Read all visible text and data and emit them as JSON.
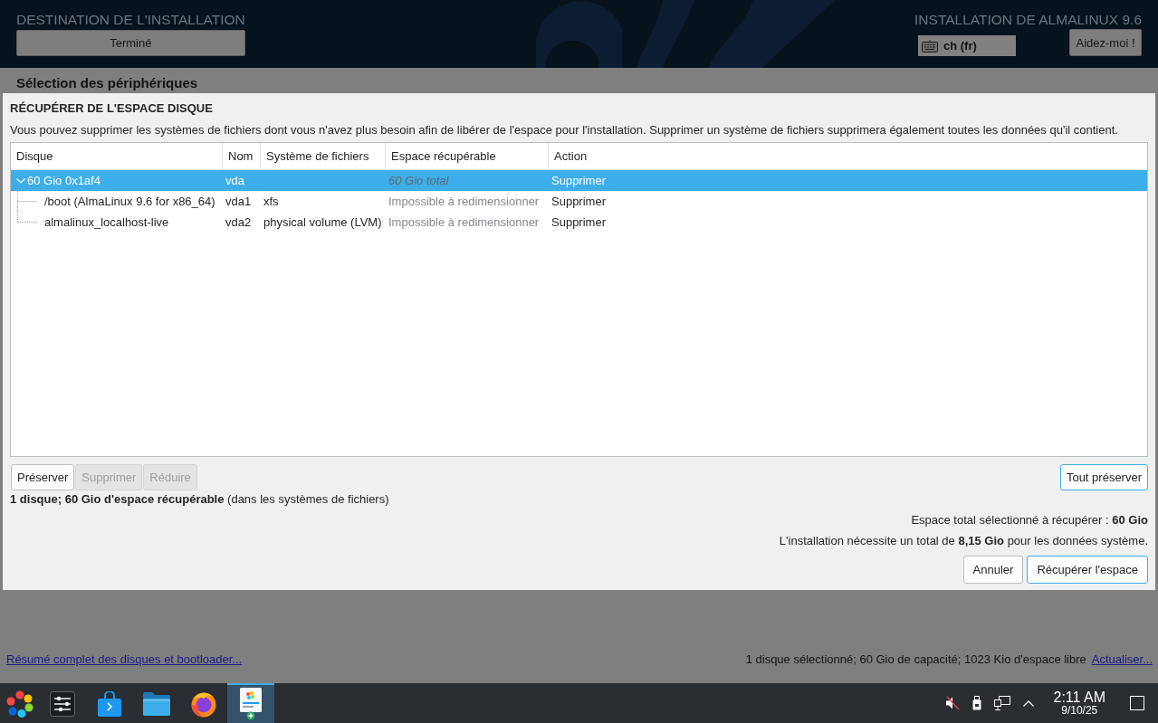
{
  "header": {
    "title": "DESTINATION DE L'INSTALLATION",
    "done_button": "Terminé",
    "product": "INSTALLATION DE ALMALINUX 9.6",
    "keyboard_layout": "ch (fr)",
    "help_button": "Aidez-moi !"
  },
  "section_title": "Sélection des périphériques",
  "dialog": {
    "title": "RÉCUPÉRER DE L'ESPACE DISQUE",
    "description": "Vous pouvez supprimer les systèmes de fichiers dont vous n'avez plus besoin afin de libérer de l'espace pour l'installation. Supprimer un système de fichiers supprimera également toutes les données qu'il contient.",
    "table": {
      "columns": [
        "Disque",
        "Nom",
        "Système de fichiers",
        "Espace récupérable",
        "Action"
      ],
      "rows": [
        {
          "disk": "60 Gio 0x1af4",
          "name": "vda",
          "reclaimable": "60 Gio total",
          "action": "Supprimer",
          "selected": true,
          "expanded": true,
          "children": [
            {
              "disk": "/boot (AlmaLinux 9.6 for x86_64)",
              "name": "vda1",
              "filesystem": "xfs",
              "reclaimable": "Impossible à redimensionner",
              "action": "Supprimer",
              "selected": false
            },
            {
              "disk": "almalinux_localhost-live",
              "name": "vda2",
              "filesystem": "physical volume (LVM)",
              "reclaimable": "Impossible à redimensionner",
              "action": "Supprimer",
              "selected": false
            }
          ]
        }
      ]
    },
    "tree_buttons": [
      {
        "label": "Préserver",
        "disabled": false
      },
      {
        "label": "Supprimer",
        "disabled": true
      },
      {
        "label": "Réduire",
        "disabled": true
      }
    ],
    "preserve_all_button": {
      "label": "Tout préserver",
      "highlighted": true
    },
    "summary": "**1 disque; 60 Gio d'espace récupérable** (dans les systèmes de fichiers)",
    "selected_total": "Espace total sélectionné à récupérer : **60 Gio**",
    "required_space": "L'installation nécessite un total de **8,15 Gio** pour les données système.",
    "actions": [
      {
        "label": "Annuler",
        "highlighted": false
      },
      {
        "label": "Récupérer l'espace",
        "highlighted": true
      }
    ]
  },
  "footer": {
    "summary_link": "Résumé complet des disques et bootloader...",
    "status": "1 disque sélectionné; 60 Gio de capacité; 1023 Kio d'espace libre",
    "refresh_link": "Actualiser..."
  },
  "taskbar": {
    "apps": [
      {
        "kind": "launcher",
        "selected": false
      },
      {
        "kind": "settings",
        "selected": false
      },
      {
        "kind": "store",
        "selected": false
      },
      {
        "kind": "files",
        "selected": false
      },
      {
        "kind": "browser",
        "selected": false
      },
      {
        "kind": "installer",
        "selected": true
      }
    ],
    "volume": {
      "muted": true
    },
    "clock": {
      "time": "2:11 AM",
      "date": "9/10/25"
    }
  }
}
